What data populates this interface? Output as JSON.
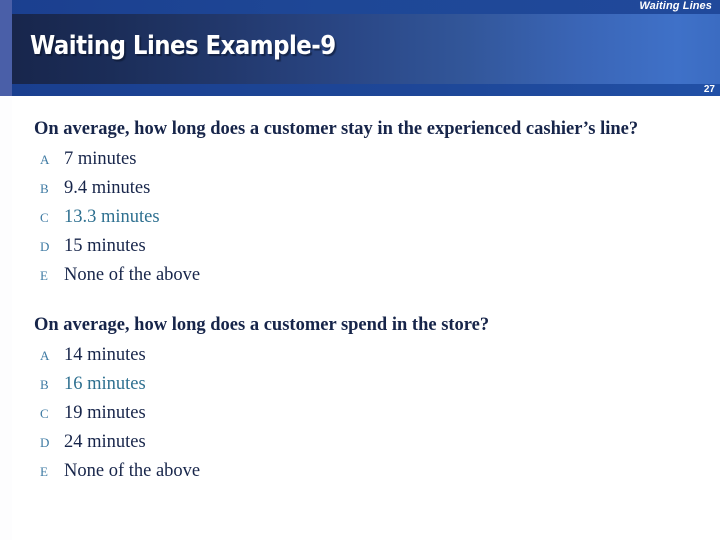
{
  "slide": {
    "running_head": "Waiting Lines",
    "title": "Waiting Lines Example-9",
    "slide_number": "27",
    "colors": {
      "banner_blue": "#1e4796",
      "title_gradient_start": "#18264c",
      "title_gradient_end": "#3f71c8",
      "left_strip": "#4a5fa8",
      "body_text": "#17254a",
      "option_letter": "#3e7aa3",
      "highlight_text": "#2e7090",
      "background": "#ffffff"
    }
  },
  "questions": [
    {
      "text": "On average, how long does a customer stay in the experienced cashier’s line?",
      "options": [
        {
          "letter": "A",
          "text": "7 minutes",
          "highlighted": false
        },
        {
          "letter": "B",
          "text": "9.4 minutes",
          "highlighted": false
        },
        {
          "letter": "C",
          "text": "13.3 minutes",
          "highlighted": true
        },
        {
          "letter": "D",
          "text": "15 minutes",
          "highlighted": false
        },
        {
          "letter": "E",
          "text": "None of the above",
          "highlighted": false
        }
      ]
    },
    {
      "text": "On average, how long does a customer spend in the store?",
      "options": [
        {
          "letter": "A",
          "text": "14 minutes",
          "highlighted": false
        },
        {
          "letter": "B",
          "text": "16 minutes",
          "highlighted": true
        },
        {
          "letter": "C",
          "text": "19 minutes",
          "highlighted": false
        },
        {
          "letter": "D",
          "text": "24 minutes",
          "highlighted": false
        },
        {
          "letter": "E",
          "text": "None of the above",
          "highlighted": false
        }
      ]
    }
  ]
}
